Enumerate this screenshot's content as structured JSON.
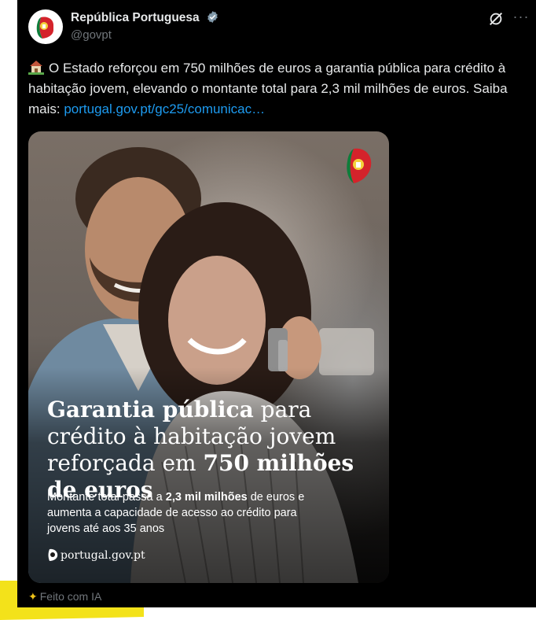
{
  "account": {
    "display_name": "República Portuguesa",
    "handle": "@govpt"
  },
  "post": {
    "emoji": "house-with-garden",
    "text": "O Estado reforçou em 750 milhões de euros a garantia pública para crédito à habitação jovem, elevando o montante total para 2,3 mil milhões de euros. Saiba mais: ",
    "link_text": "portugal.gov.pt/gc25/comunicac…"
  },
  "media": {
    "headline_bold_1": "Garantia pública",
    "headline_normal_1": " para crédito à habitação jovem reforçada em ",
    "headline_bold_2": "750 milhões de euros",
    "sub_1": "Montante total passa a ",
    "sub_bold": "2,3 mil milhões",
    "sub_2": " de euros e aumenta a capacidade de acesso ao crédito para jovens até aos 35 anos",
    "site": "portugal.gov.pt"
  },
  "ai_note": "Feito com IA",
  "icons": {
    "verified": "verified-badge-icon",
    "grok": "grok-icon",
    "more": "more-icon",
    "spark": "sparkle-icon"
  },
  "colors": {
    "background": "#000000",
    "text": "#e7e9ea",
    "muted": "#71767b",
    "link": "#1d9bf0",
    "accent_yellow": "#f3e21a"
  }
}
